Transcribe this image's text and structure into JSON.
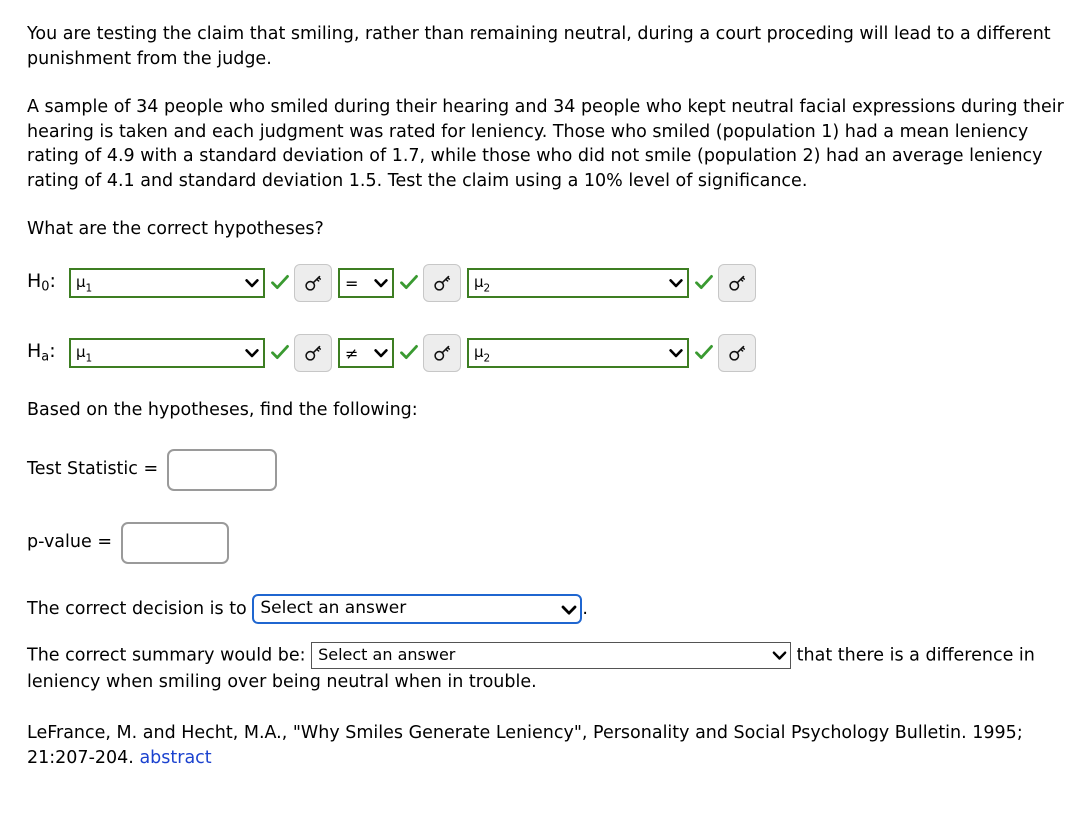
{
  "problem": {
    "intro_paragraph": "You are testing the claim that smiling, rather than remaining neutral, during a court proceding will lead to a different punishment from the judge.",
    "scenario_paragraph": "A sample of 34 people who smiled during their hearing and 34 people who kept neutral facial expressions during their hearing is taken and each judgment was rated for leniency. Those who smiled (population 1) had a mean leniency rating of 4.9 with a standard deviation of 1.7, while those who did not smile (population 2) had an average leniency rating of 4.1 and standard deviation 1.5. Test the claim using a 10% level of significance.",
    "hypotheses_prompt": "What are the correct hypotheses?",
    "find_following_prompt": "Based on the hypotheses, find the following:"
  },
  "hypotheses": {
    "null_row": {
      "label": "H",
      "label_sub": "0",
      "label_colon": ":",
      "param1_value": "μ",
      "param1_sub": "1",
      "operator_value": "=",
      "param2_value": "μ",
      "param2_sub": "2"
    },
    "alt_row": {
      "label": "H",
      "label_sub": "a",
      "label_colon": ":",
      "param1_value": "μ",
      "param1_sub": "1",
      "operator_value": "≠",
      "param2_value": "μ",
      "param2_sub": "2"
    },
    "correct_icon": "check-icon",
    "help_icon": "key-icon"
  },
  "answers": {
    "test_statistic_label": "Test Statistic  =",
    "test_statistic_value": "",
    "test_statistic_placeholder": "",
    "p_value_label": "p-value  =",
    "p_value_value": "",
    "p_value_placeholder": ""
  },
  "decision": {
    "prefix": "The correct decision is to",
    "select_value": "Select an answer",
    "suffix": "."
  },
  "summary": {
    "prefix": "The correct summary would be:",
    "select_value": "Select an answer",
    "suffix_line1": "that there is a",
    "suffix_line2": "difference in leniency when smiling over being neutral when in trouble."
  },
  "citation": {
    "text_line1": "LeFrance, M. and Hecht, M.A., \"Why Smiles Generate Leniency\", Personality and Social Psychology Bulletin.",
    "text_line2_prefix": "1995; 21:207-204.",
    "link_text": "abstract"
  },
  "colors": {
    "valid_green": "#3d7e22",
    "check_green": "#3a9a31",
    "focus_blue": "#1f66d0",
    "link_blue": "#1b42cf",
    "input_gray": "#9a9a9a",
    "button_bg": "#ededed"
  }
}
